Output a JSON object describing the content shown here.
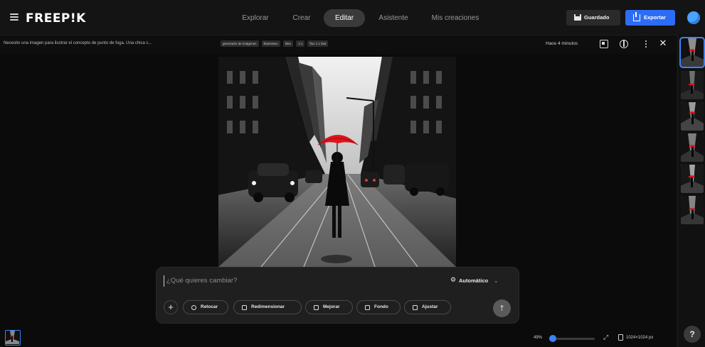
{
  "header": {
    "logo": "FREEP!K",
    "tabs": [
      {
        "label": "Explorar",
        "active": false
      },
      {
        "label": "Crear",
        "active": false
      },
      {
        "label": "Editar",
        "active": true
      },
      {
        "label": "Asistente",
        "active": false
      },
      {
        "label": "Mis creaciones",
        "active": false
      }
    ],
    "saved_label": "Guardado",
    "export_label": "Exportar",
    "accent_color": "#2d6df6"
  },
  "subbar": {
    "prompt": "Necesito una imagen para ilustrar el concepto de punto de fuga. Una chica c...",
    "tags": [
      "generador de imágenes",
      "illustration",
      "bike",
      "1:1",
      "flux 1.1 fast"
    ],
    "time": "Hace 4 minutos"
  },
  "composer": {
    "placeholder": "¿Qué quieres cambiar?",
    "mode_label": "Automático",
    "chips": [
      "Retocar",
      "Redimensionar",
      "Mejorar",
      "Fondo",
      "Ajustar"
    ]
  },
  "footer": {
    "zoom": "49%",
    "zoom_value": 0.49,
    "dimensions": "1024×1024 px"
  },
  "thumbnails_count": 6
}
